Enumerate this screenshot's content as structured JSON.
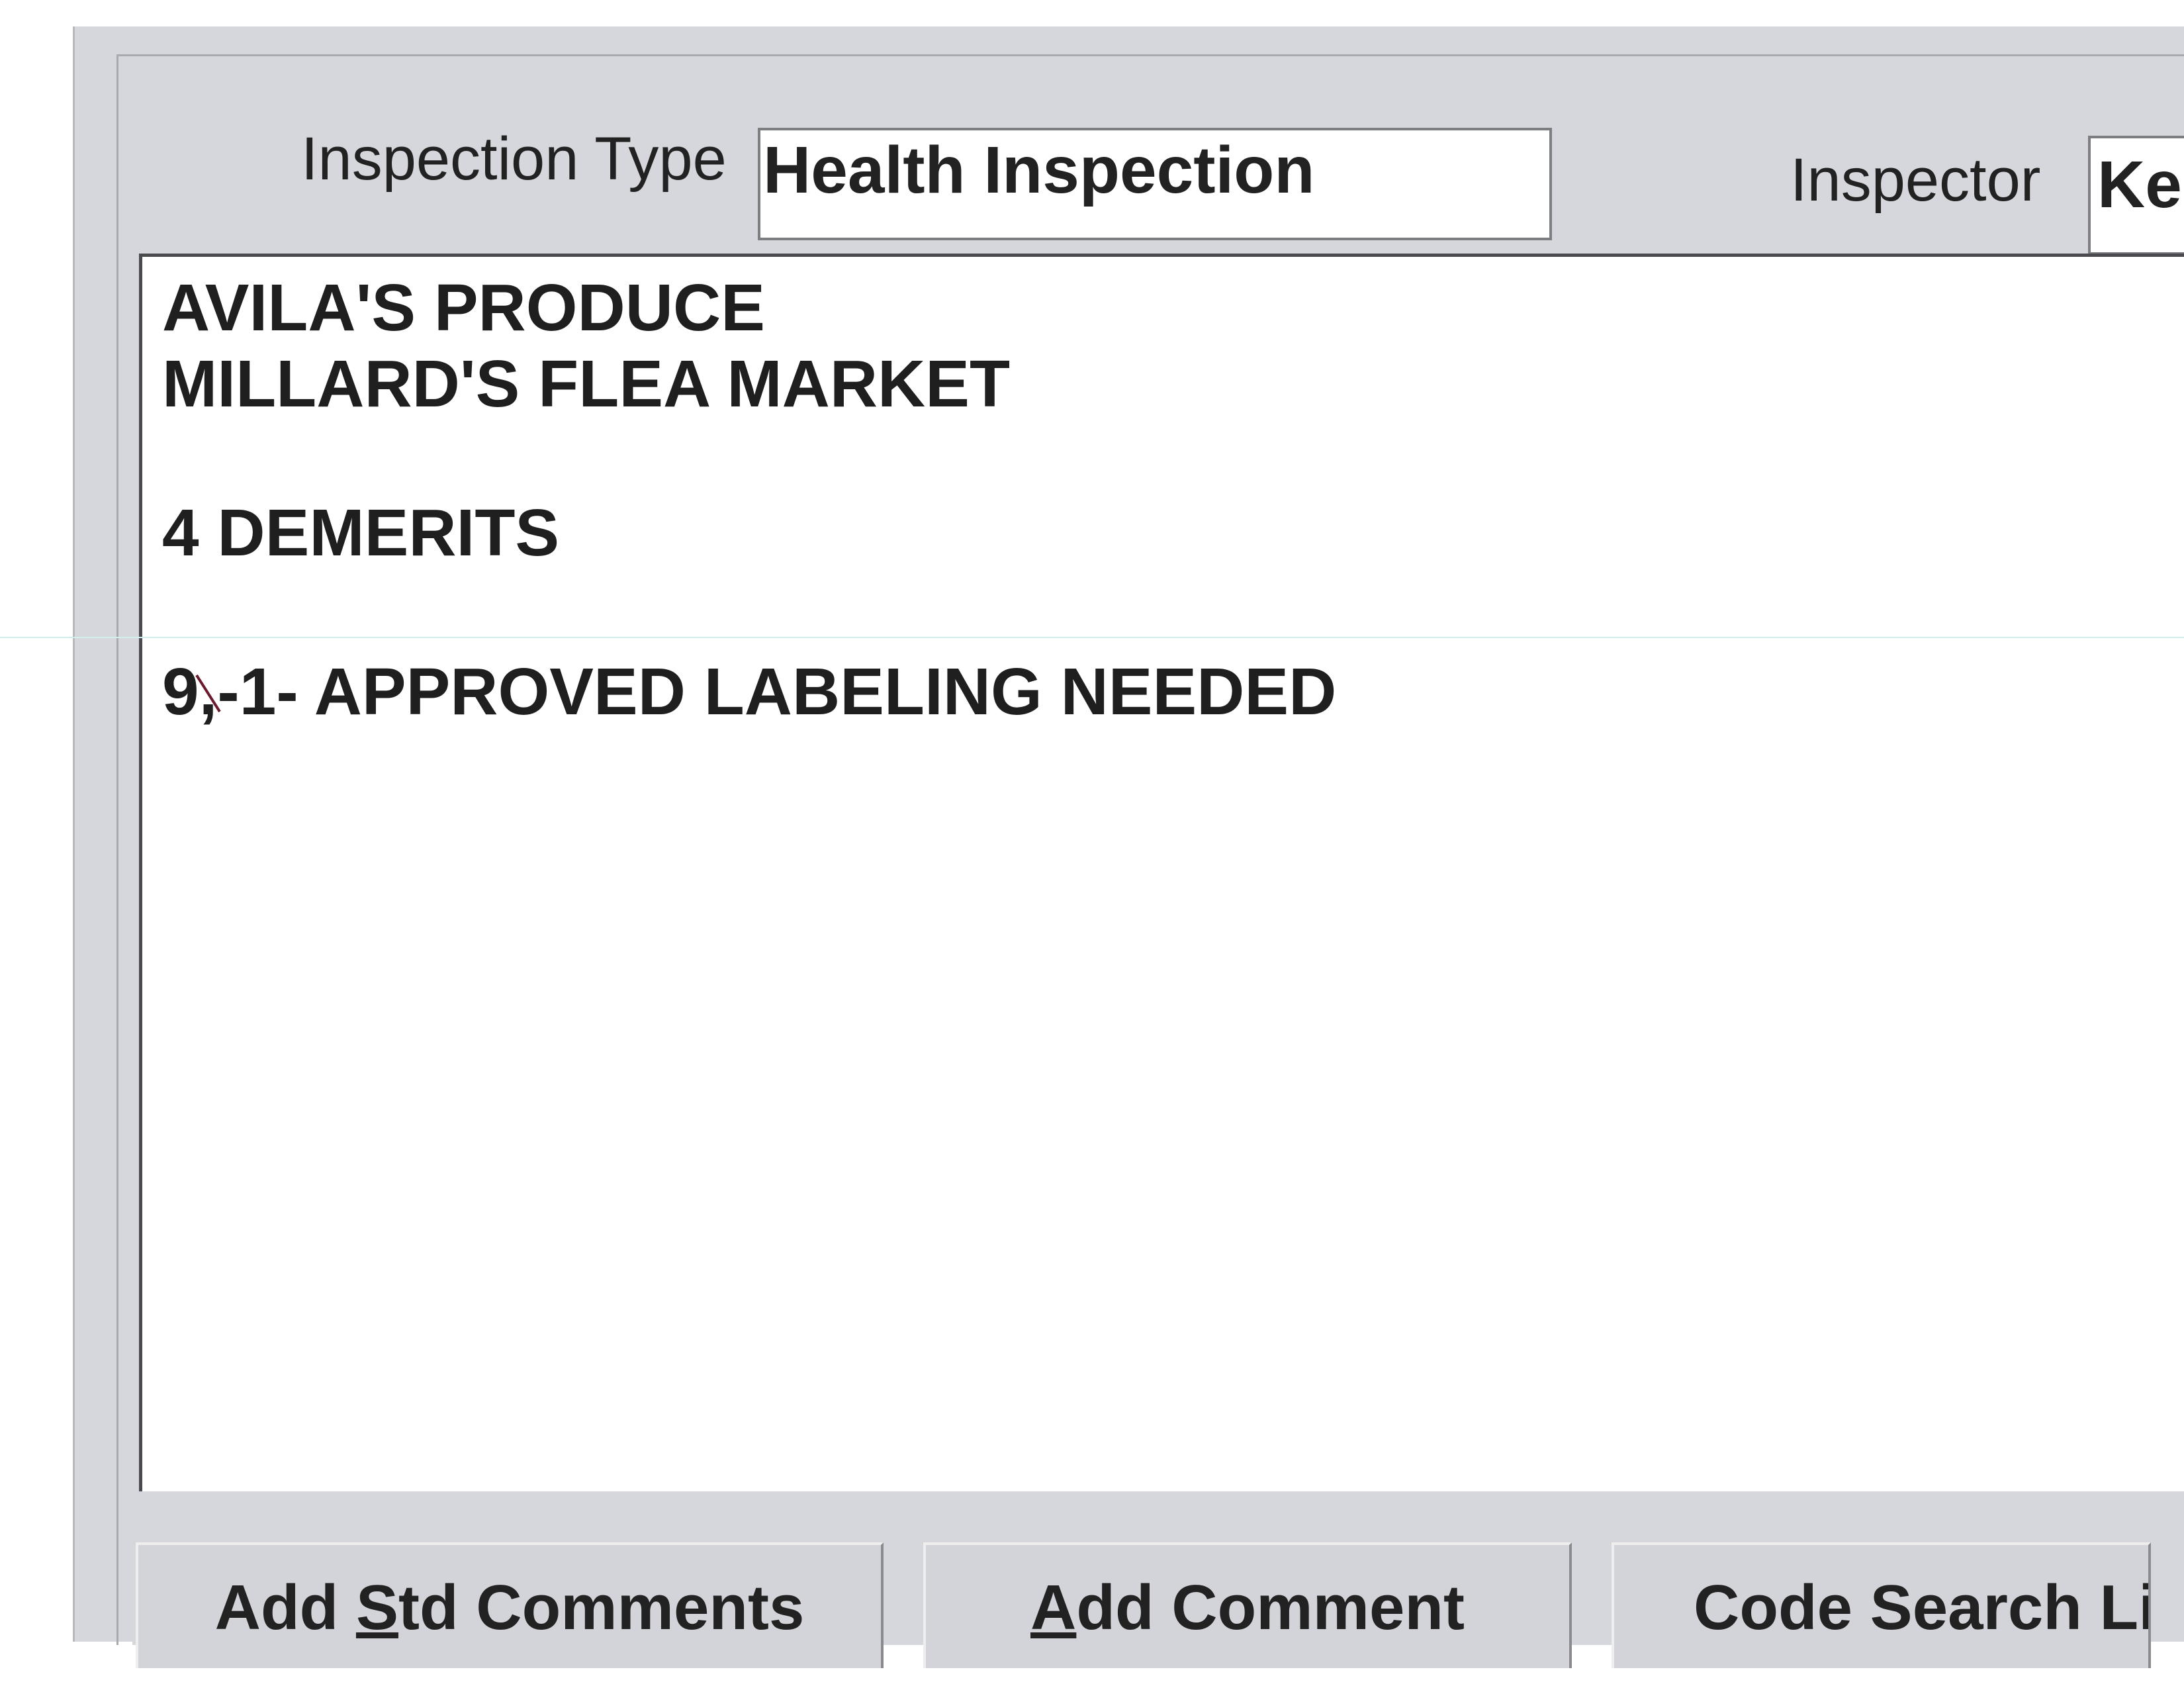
{
  "form": {
    "inspection_type_label": "Inspection Type",
    "inspection_type_value": "Health Inspection",
    "inspector_label": "Inspector",
    "inspector_value": "Ke"
  },
  "comments": {
    "lines": [
      "AVILA'S PRODUCE",
      "MILLARD'S FLEA MARKET",
      "4 DEMERITS",
      "9,-1- APPROVED LABELING NEEDED"
    ]
  },
  "buttons": {
    "add_std_comments": {
      "pre": "Add ",
      "mnemonic": "S",
      "post": "td Comments"
    },
    "add_comment": {
      "pre": "",
      "mnemonic": "A",
      "post": "dd Comment"
    },
    "code_search": {
      "label": "Code Search Li"
    }
  }
}
